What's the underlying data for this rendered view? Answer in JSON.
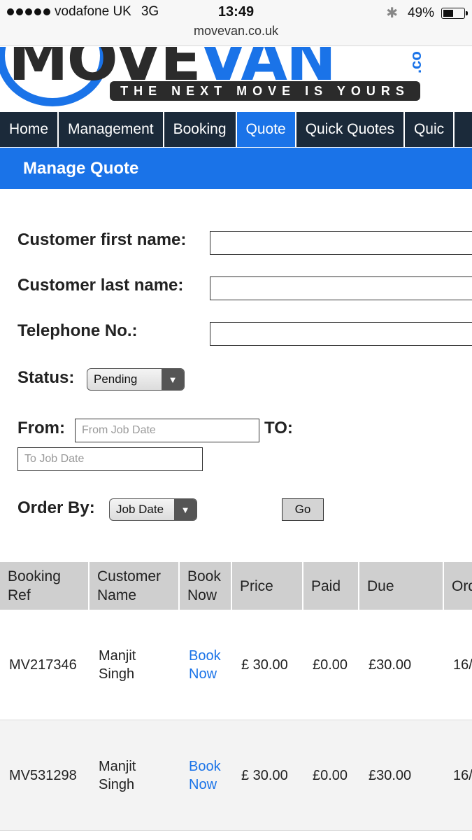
{
  "status_bar": {
    "carrier": "vodafone UK",
    "network": "3G",
    "time": "13:49",
    "battery": "49%",
    "battery_level": 0.49,
    "url": "movevan.co.uk"
  },
  "logo": {
    "wordmark_dark": "MO",
    "wordmark_dark2": "VE",
    "wordmark_blue": "VAN",
    "domain_suffix": ".co",
    "tagline": "THE NEXT MOVE IS YOURS"
  },
  "nav": {
    "items": [
      {
        "label": "Home"
      },
      {
        "label": "Management"
      },
      {
        "label": "Booking"
      },
      {
        "label": "Quote",
        "active": true
      },
      {
        "label": "Quick Quotes"
      },
      {
        "label": "Quic"
      }
    ]
  },
  "section": {
    "title": "Manage Quote"
  },
  "form": {
    "first_name_label": "Customer first name:",
    "last_name_label": "Customer last name:",
    "telephone_label": "Telephone No.:",
    "status_label": "Status:",
    "status_value": "Pending",
    "from_label": "From:",
    "from_placeholder": "From Job Date",
    "to_label": "TO:",
    "to_placeholder": "To Job Date",
    "order_by_label": "Order By:",
    "order_by_value": "Job Date",
    "go_label": "Go"
  },
  "table": {
    "headers": [
      {
        "line1": "Booking",
        "line2": "Ref"
      },
      {
        "line1": "Customer",
        "line2": "Name"
      },
      {
        "line1": "Book",
        "line2": "Now"
      },
      {
        "line1": "Price",
        "line2": ""
      },
      {
        "line1": "Paid",
        "line2": ""
      },
      {
        "line1": "Due",
        "line2": ""
      },
      {
        "line1": "Ord",
        "line2": ""
      }
    ],
    "rows": [
      {
        "ref": "MV217346",
        "name_line1": "Manjit",
        "name_line2": "Singh",
        "book_line1": "Book",
        "book_line2": "Now",
        "price": "£ 30.00",
        "paid": "£0.00",
        "due": "£30.00",
        "order": "16/"
      },
      {
        "ref": "MV531298",
        "name_line1": "Manjit",
        "name_line2": "Singh",
        "book_line1": "Book",
        "book_line2": "Now",
        "price": "£ 30.00",
        "paid": "£0.00",
        "due": "£30.00",
        "order": "16/"
      }
    ]
  },
  "colors": {
    "accent": "#1a73e8",
    "nav_bg": "#1b2a3a",
    "header_bg": "#cfcfcf"
  }
}
